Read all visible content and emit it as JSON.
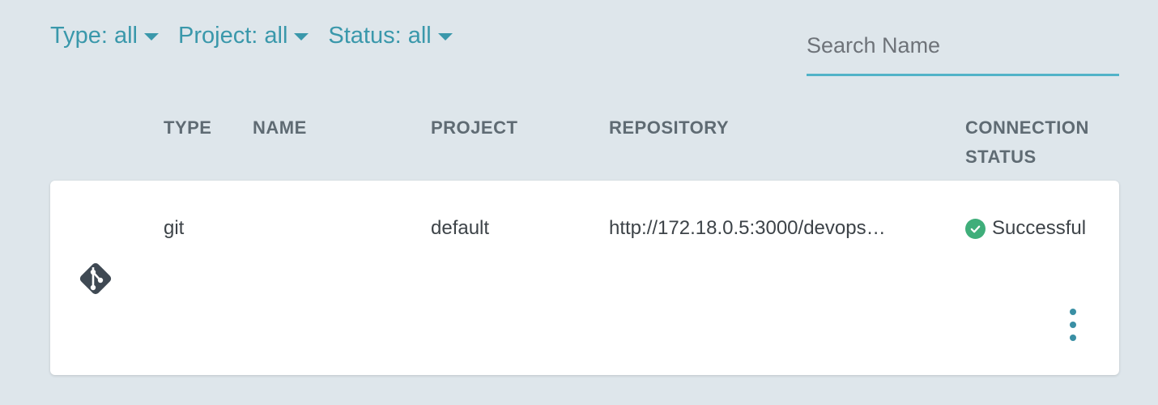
{
  "filters": [
    {
      "label": "Type: all"
    },
    {
      "label": "Project: all"
    },
    {
      "label": "Status: all"
    }
  ],
  "search": {
    "placeholder": "Search Name",
    "value": ""
  },
  "columns": {
    "type": "TYPE",
    "name": "NAME",
    "project": "PROJECT",
    "repository": "REPOSITORY",
    "connection_status_line1": "CONNECTION",
    "connection_status_line2": "STATUS"
  },
  "rows": [
    {
      "icon": "git-icon",
      "type": "git",
      "name": "",
      "project": "default",
      "repository": "http://172.18.0.5:3000/devops…",
      "status": "Successful",
      "status_icon": "check-circle-icon"
    }
  ],
  "colors": {
    "accent": "#3a98ab",
    "search_underline": "#51b3c8",
    "success": "#3fae7a",
    "background": "#dee6eb"
  }
}
